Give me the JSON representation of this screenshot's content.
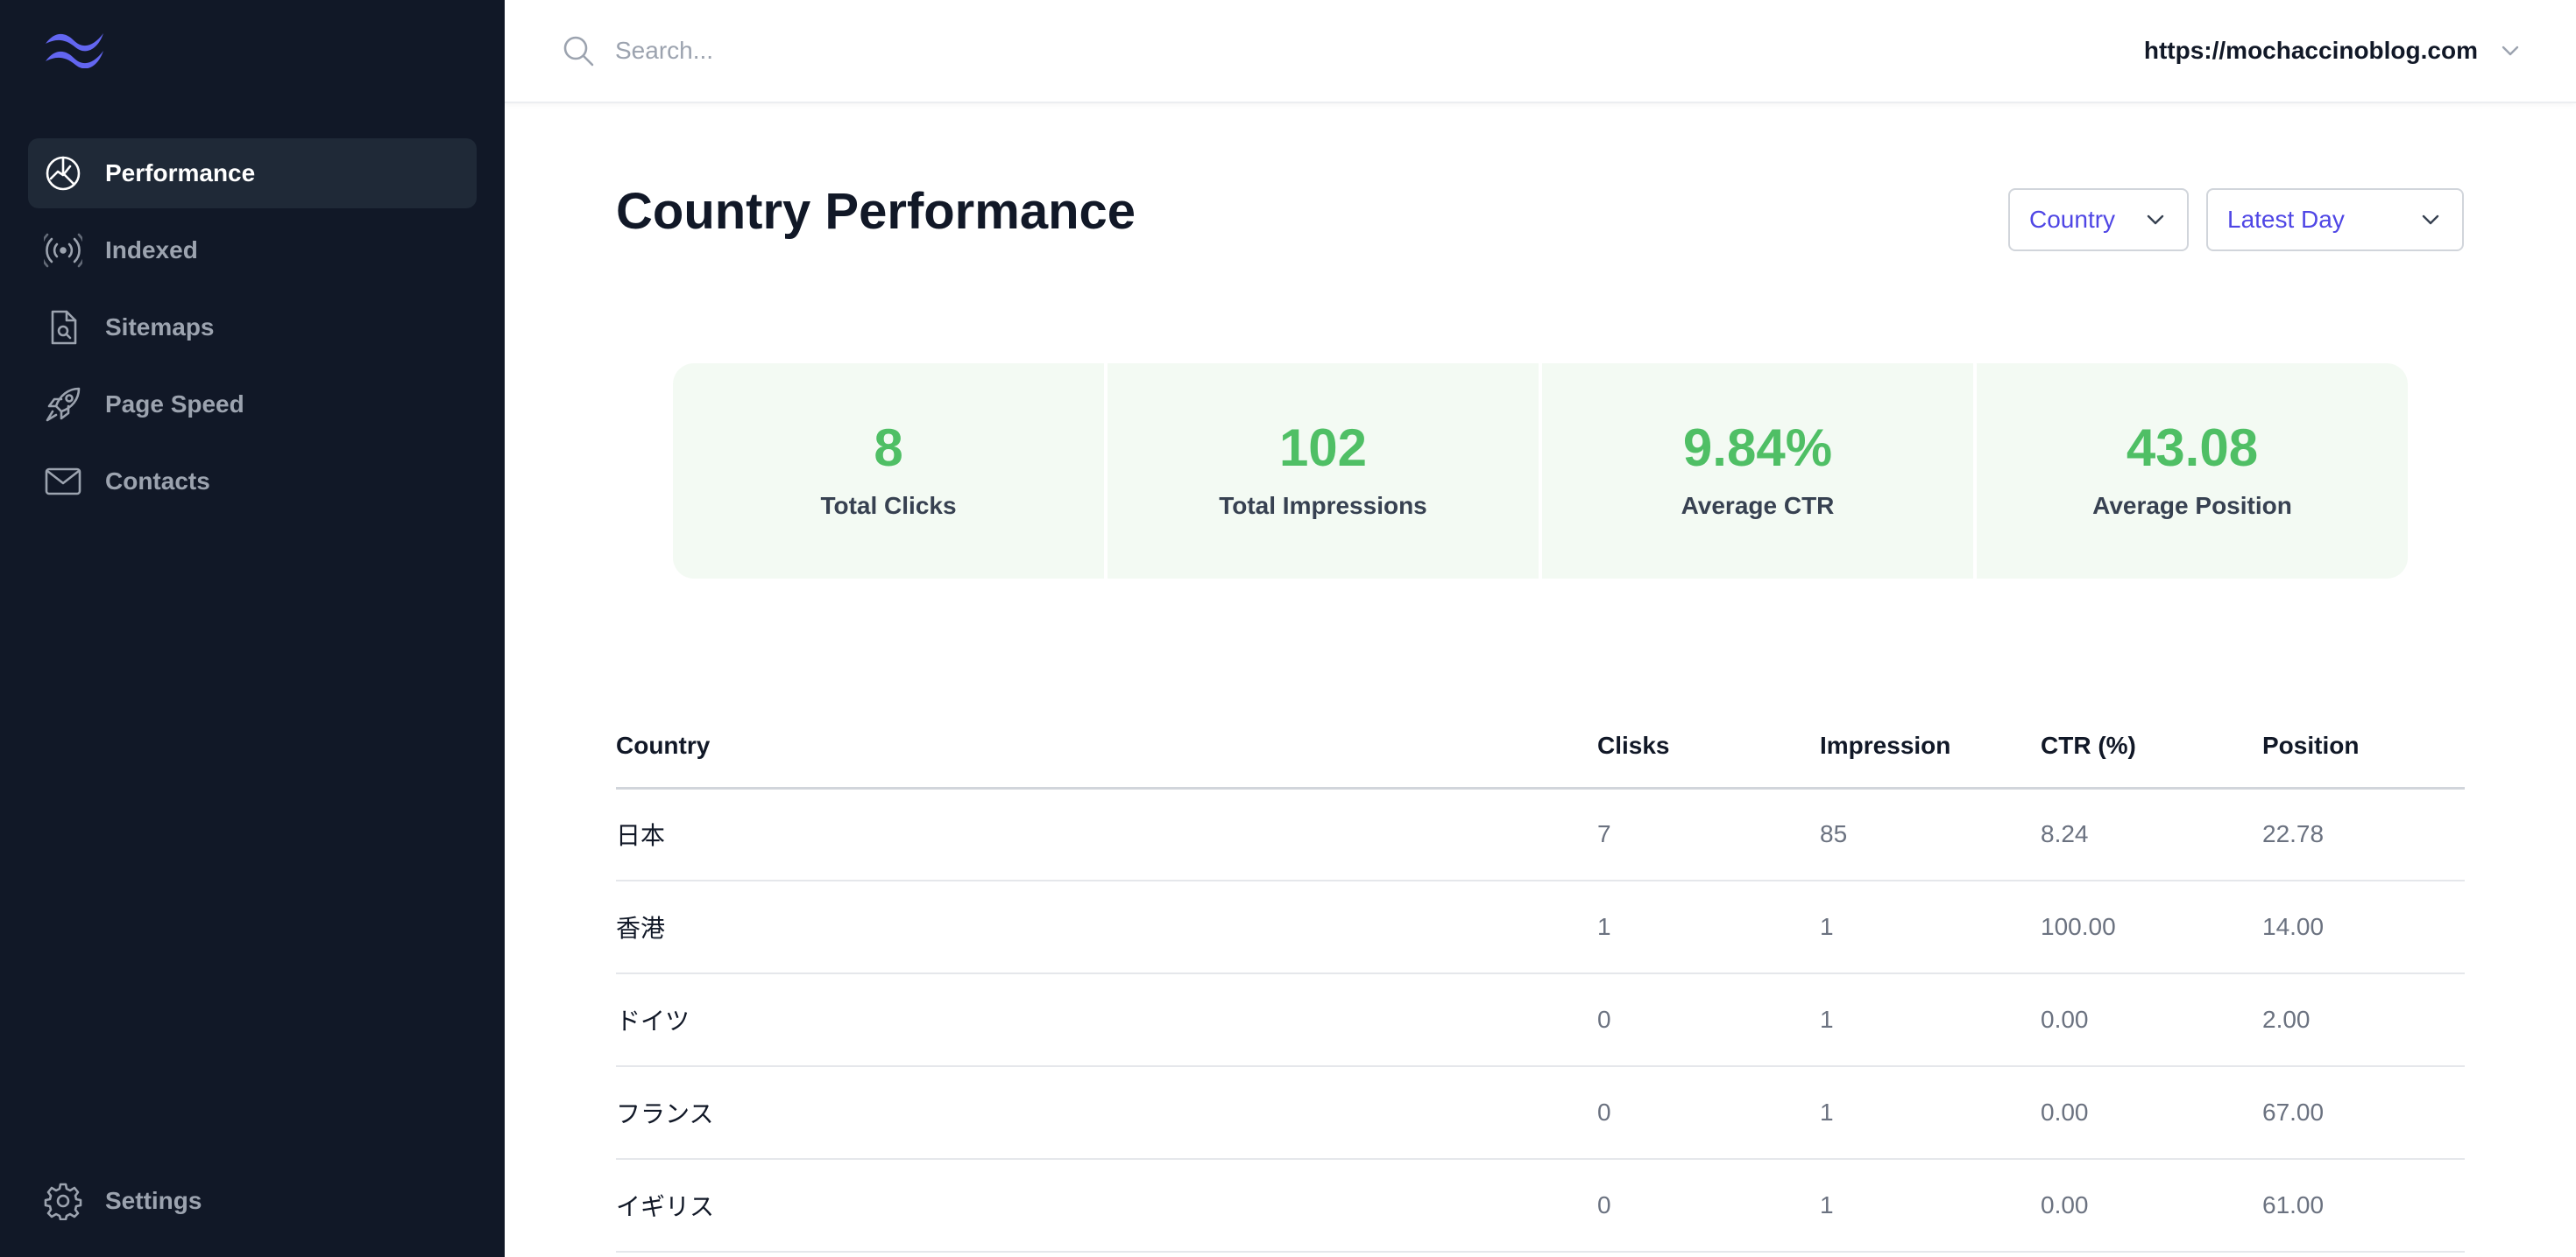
{
  "sidebar": {
    "logo": "tailwind-wave-logo",
    "items": [
      {
        "label": "Performance",
        "icon": "chart-pie-icon",
        "active": true
      },
      {
        "label": "Indexed",
        "icon": "signal-icon",
        "active": false
      },
      {
        "label": "Sitemaps",
        "icon": "document-search-icon",
        "active": false
      },
      {
        "label": "Page Speed",
        "icon": "rocket-icon",
        "active": false
      },
      {
        "label": "Contacts",
        "icon": "envelope-icon",
        "active": false
      }
    ],
    "settings": {
      "label": "Settings",
      "icon": "gear-icon"
    }
  },
  "topbar": {
    "search_placeholder": "Search...",
    "site": "https://mochaccinoblog.com"
  },
  "page": {
    "title": "Country Performance",
    "filters": {
      "dimension": "Country",
      "range": "Latest Day"
    }
  },
  "stats": [
    {
      "value": "8",
      "label": "Total Clicks"
    },
    {
      "value": "102",
      "label": "Total Impressions"
    },
    {
      "value": "9.84%",
      "label": "Average CTR"
    },
    {
      "value": "43.08",
      "label": "Average Position"
    }
  ],
  "table": {
    "headers": [
      "Country",
      "Clisks",
      "Impression",
      "CTR (%)",
      "Position"
    ],
    "rows": [
      [
        "日本",
        "7",
        "85",
        "8.24",
        "22.78"
      ],
      [
        "香港",
        "1",
        "1",
        "100.00",
        "14.00"
      ],
      [
        "ドイツ",
        "0",
        "1",
        "0.00",
        "2.00"
      ],
      [
        "フランス",
        "0",
        "1",
        "0.00",
        "67.00"
      ],
      [
        "イギリス",
        "0",
        "1",
        "0.00",
        "61.00"
      ]
    ]
  },
  "colors": {
    "sidebar_bg": "#111827",
    "sidebar_active": "#1f2937",
    "accent": "#4f46e5",
    "logo": "#6366f1",
    "stat_green": "#4fbf65",
    "stat_bg": "#f3faf3"
  }
}
